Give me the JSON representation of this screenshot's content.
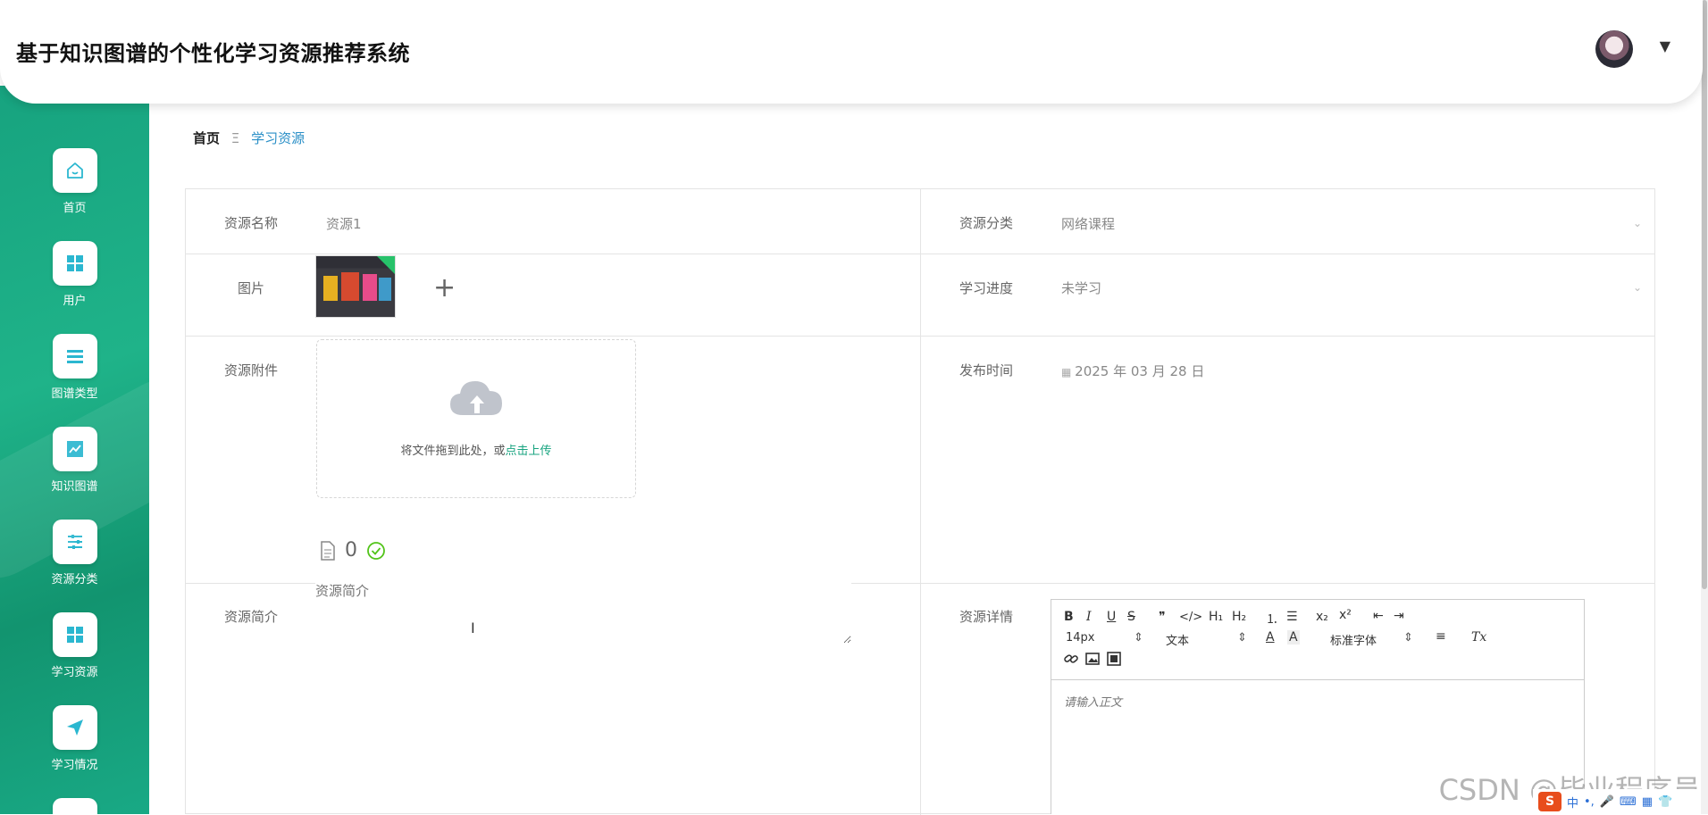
{
  "header": {
    "title": "基于知识图谱的个性化学习资源推荐系统"
  },
  "sidebar": {
    "items": [
      {
        "label": "首页",
        "icon": "home-icon"
      },
      {
        "label": "用户",
        "icon": "grid-icon"
      },
      {
        "label": "图谱类型",
        "icon": "list-icon"
      },
      {
        "label": "知识图谱",
        "icon": "chart-icon"
      },
      {
        "label": "资源分类",
        "icon": "sliders-icon"
      },
      {
        "label": "学习资源",
        "icon": "grid-icon"
      },
      {
        "label": "学习情况",
        "icon": "paper-plane-icon"
      }
    ]
  },
  "breadcrumb": {
    "home": "首页",
    "separator": "Ξ",
    "current": "学习资源"
  },
  "form": {
    "name_label": "资源名称",
    "name_value": "资源1",
    "category_label": "资源分类",
    "category_value": "网络课程",
    "image_label": "图片",
    "add_symbol": "+",
    "progress_label": "学习进度",
    "progress_value": "未学习",
    "attachment_label": "资源附件",
    "upload_text": "将文件拖到此处，或",
    "upload_link": "点击上传",
    "file_count": "0",
    "publish_label": "发布时间",
    "publish_value": "2025 年 03 月 28 日",
    "intro_label": "资源简介",
    "intro_placeholder": "资源简介",
    "detail_label": "资源详情"
  },
  "editor": {
    "bold": "B",
    "italic": "I",
    "underline": "U",
    "strike": "S",
    "quote": "❞",
    "code": "</>",
    "h1": "H₁",
    "h2": "H₂",
    "ordered_list": "⒈",
    "bullet_list": "☰",
    "subscript": "x₂",
    "superscript": "x²",
    "outdent": "⇤",
    "indent": "⇥",
    "font_size": "14px",
    "format": "文本",
    "font_family": "标准字体",
    "color": "A",
    "background": "A",
    "align": "≡",
    "clear": "Tx",
    "placeholder": "请输入正文"
  },
  "watermark": "CSDN @毕业程序员",
  "tray": {
    "ime": "中",
    "s": "S"
  }
}
